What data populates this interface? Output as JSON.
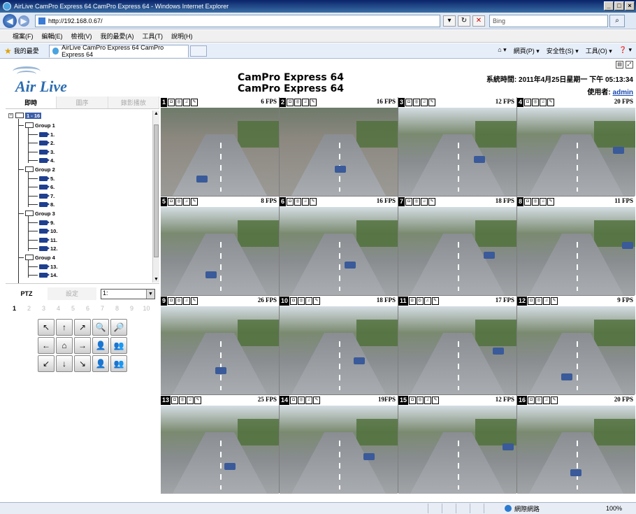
{
  "browser": {
    "title": "AirLive CamPro Express 64 CamPro Express 64 - Windows Internet Explorer",
    "url": "http://192.168.0.67/",
    "search_placeholder": "Bing",
    "menu": [
      "檔案(F)",
      "編輯(E)",
      "檢視(V)",
      "我的最愛(A)",
      "工具(T)",
      "說明(H)"
    ],
    "favorites_label": "我的最愛",
    "tab_title": "AirLive CamPro Express 64 CamPro Express 64",
    "commands": [
      "網頁(P) ▾",
      "安全性(S) ▾",
      "工具(O) ▾"
    ],
    "status_zone": "網際網路",
    "zoom": "100%"
  },
  "header": {
    "logo_text": "Air Live",
    "title_line1": "CamPro Express 64",
    "title_line2": "CamPro Express 64",
    "system_time_label": "系統時間:",
    "system_time_value": "2011年4月25日星期一 下午 05:13:34",
    "user_label": "使用者:",
    "user_name": "admin"
  },
  "left": {
    "mode_tabs": [
      "即時",
      "圖序",
      "錄影播放"
    ],
    "tree_root": "1 - 16",
    "groups": [
      {
        "name": "Group 1",
        "cams": [
          "1.",
          "2.",
          "3.",
          "4."
        ]
      },
      {
        "name": "Group 2",
        "cams": [
          "5.",
          "6.",
          "7.",
          "8."
        ]
      },
      {
        "name": "Group 3",
        "cams": [
          "9.",
          "10.",
          "11.",
          "12."
        ]
      },
      {
        "name": "Group 4",
        "cams": [
          "13.",
          "14."
        ]
      }
    ],
    "ptz_tab": "PTZ",
    "settings_tab": "設定",
    "ptz_select": "1:",
    "presets": [
      "1",
      "2",
      "3",
      "4",
      "5",
      "6",
      "7",
      "8",
      "9",
      "10"
    ]
  },
  "cameras": [
    {
      "num": "1",
      "fps": "6 FPS"
    },
    {
      "num": "2",
      "fps": "16 FPS"
    },
    {
      "num": "3",
      "fps": "12 FPS"
    },
    {
      "num": "4",
      "fps": "20 FPS"
    },
    {
      "num": "5",
      "fps": "8 FPS"
    },
    {
      "num": "6",
      "fps": "16 FPS"
    },
    {
      "num": "7",
      "fps": "18 FPS"
    },
    {
      "num": "8",
      "fps": "11 FPS"
    },
    {
      "num": "9",
      "fps": "26 FPS"
    },
    {
      "num": "10",
      "fps": "18 FPS"
    },
    {
      "num": "11",
      "fps": "17 FPS"
    },
    {
      "num": "12",
      "fps": "9 FPS"
    },
    {
      "num": "13",
      "fps": "25 FPS"
    },
    {
      "num": "14",
      "fps": "19FPS"
    },
    {
      "num": "15",
      "fps": "12 FPS"
    },
    {
      "num": "16",
      "fps": "20 FPS"
    }
  ]
}
